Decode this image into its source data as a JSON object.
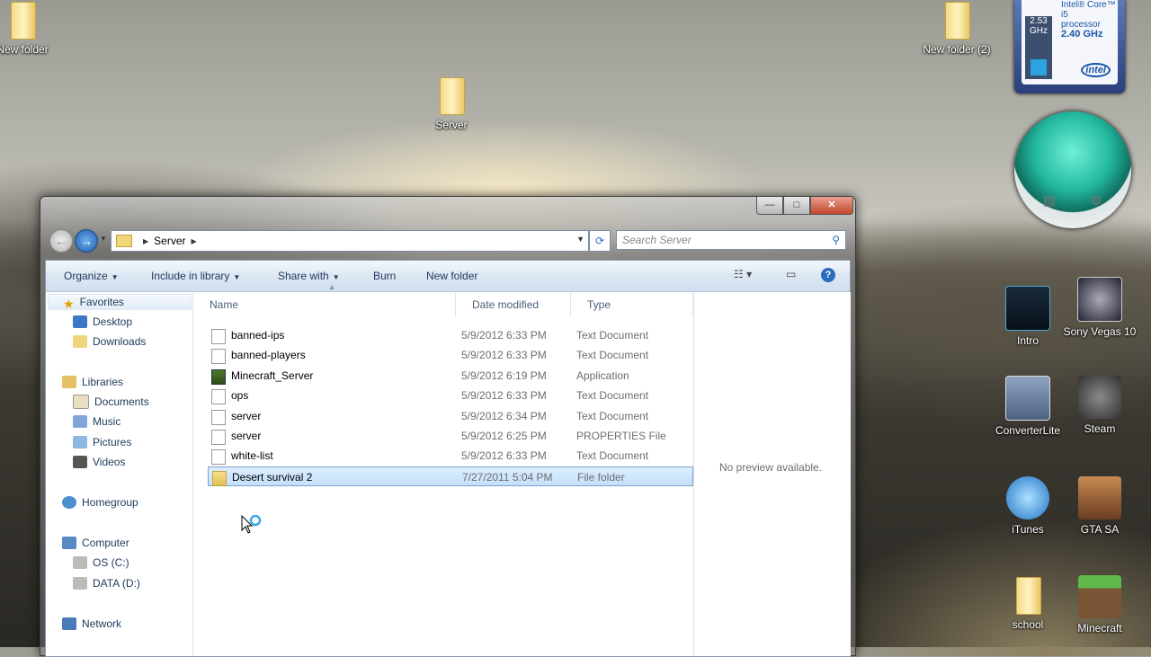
{
  "desktop": {
    "icons": [
      {
        "name": "new-folder-icon",
        "label": "New folder"
      },
      {
        "name": "server-folder-icon",
        "label": "Server"
      },
      {
        "name": "new-folder-2-icon",
        "label": "New folder (2)"
      },
      {
        "name": "intro-icon",
        "label": "Intro"
      },
      {
        "name": "sony-vegas-icon",
        "label": "Sony Vegas 10"
      },
      {
        "name": "converterlite-icon",
        "label": "ConverterLite"
      },
      {
        "name": "steam-icon",
        "label": "Steam"
      },
      {
        "name": "itunes-icon",
        "label": "iTunes"
      },
      {
        "name": "gta-sa-icon",
        "label": "GTA SA"
      },
      {
        "name": "school-icon",
        "label": "school"
      },
      {
        "name": "minecraft-icon",
        "label": "Minecraft"
      }
    ]
  },
  "cpu_gadget": {
    "ghz": "2.53",
    "ghz_unit": "GHz",
    "line1": "Intel® Core™ i5",
    "line2": "processor",
    "speed": "2.40 GHz",
    "brand": "intel"
  },
  "window": {
    "controls": {
      "minimize": "—",
      "maximize": "□",
      "close": "✕"
    },
    "address": {
      "crumb": "Server"
    },
    "search_placeholder": "Search Server",
    "toolbar": {
      "organize": "Organize",
      "include": "Include in library",
      "share": "Share with",
      "burn": "Burn",
      "new_folder": "New folder"
    },
    "nav": [
      {
        "label": "Favorites",
        "level": 0,
        "selected": true
      },
      {
        "label": "Desktop",
        "level": 1
      },
      {
        "label": "Downloads",
        "level": 1
      },
      {
        "label": "Libraries",
        "level": 0
      },
      {
        "label": "Documents",
        "level": 1
      },
      {
        "label": "Music",
        "level": 1
      },
      {
        "label": "Pictures",
        "level": 1
      },
      {
        "label": "Videos",
        "level": 1
      },
      {
        "label": "Homegroup",
        "level": 0
      },
      {
        "label": "Computer",
        "level": 0
      },
      {
        "label": "OS (C:)",
        "level": 1
      },
      {
        "label": "DATA (D:)",
        "level": 1
      },
      {
        "label": "Network",
        "level": 0
      }
    ],
    "columns": {
      "name": "Name",
      "date": "Date modified",
      "type": "Type"
    },
    "files": [
      {
        "name": "banned-ips",
        "date": "5/9/2012 6:33 PM",
        "type": "Text Document",
        "icon": "text-doc-icon"
      },
      {
        "name": "banned-players",
        "date": "5/9/2012 6:33 PM",
        "type": "Text Document",
        "icon": "text-doc-icon"
      },
      {
        "name": "Minecraft_Server",
        "date": "5/9/2012 6:19 PM",
        "type": "Application",
        "icon": "app-icon"
      },
      {
        "name": "ops",
        "date": "5/9/2012 6:33 PM",
        "type": "Text Document",
        "icon": "text-doc-icon"
      },
      {
        "name": "server",
        "date": "5/9/2012 6:34 PM",
        "type": "Text Document",
        "icon": "text-doc-icon"
      },
      {
        "name": "server",
        "date": "5/9/2012 6:25 PM",
        "type": "PROPERTIES File",
        "icon": "properties-file-icon"
      },
      {
        "name": "white-list",
        "date": "5/9/2012 6:33 PM",
        "type": "Text Document",
        "icon": "text-doc-icon"
      },
      {
        "name": "Desert survival 2",
        "date": "7/27/2011 5:04 PM",
        "type": "File folder",
        "icon": "folder-icon",
        "selected": true
      }
    ],
    "preview_text": "No preview available."
  }
}
